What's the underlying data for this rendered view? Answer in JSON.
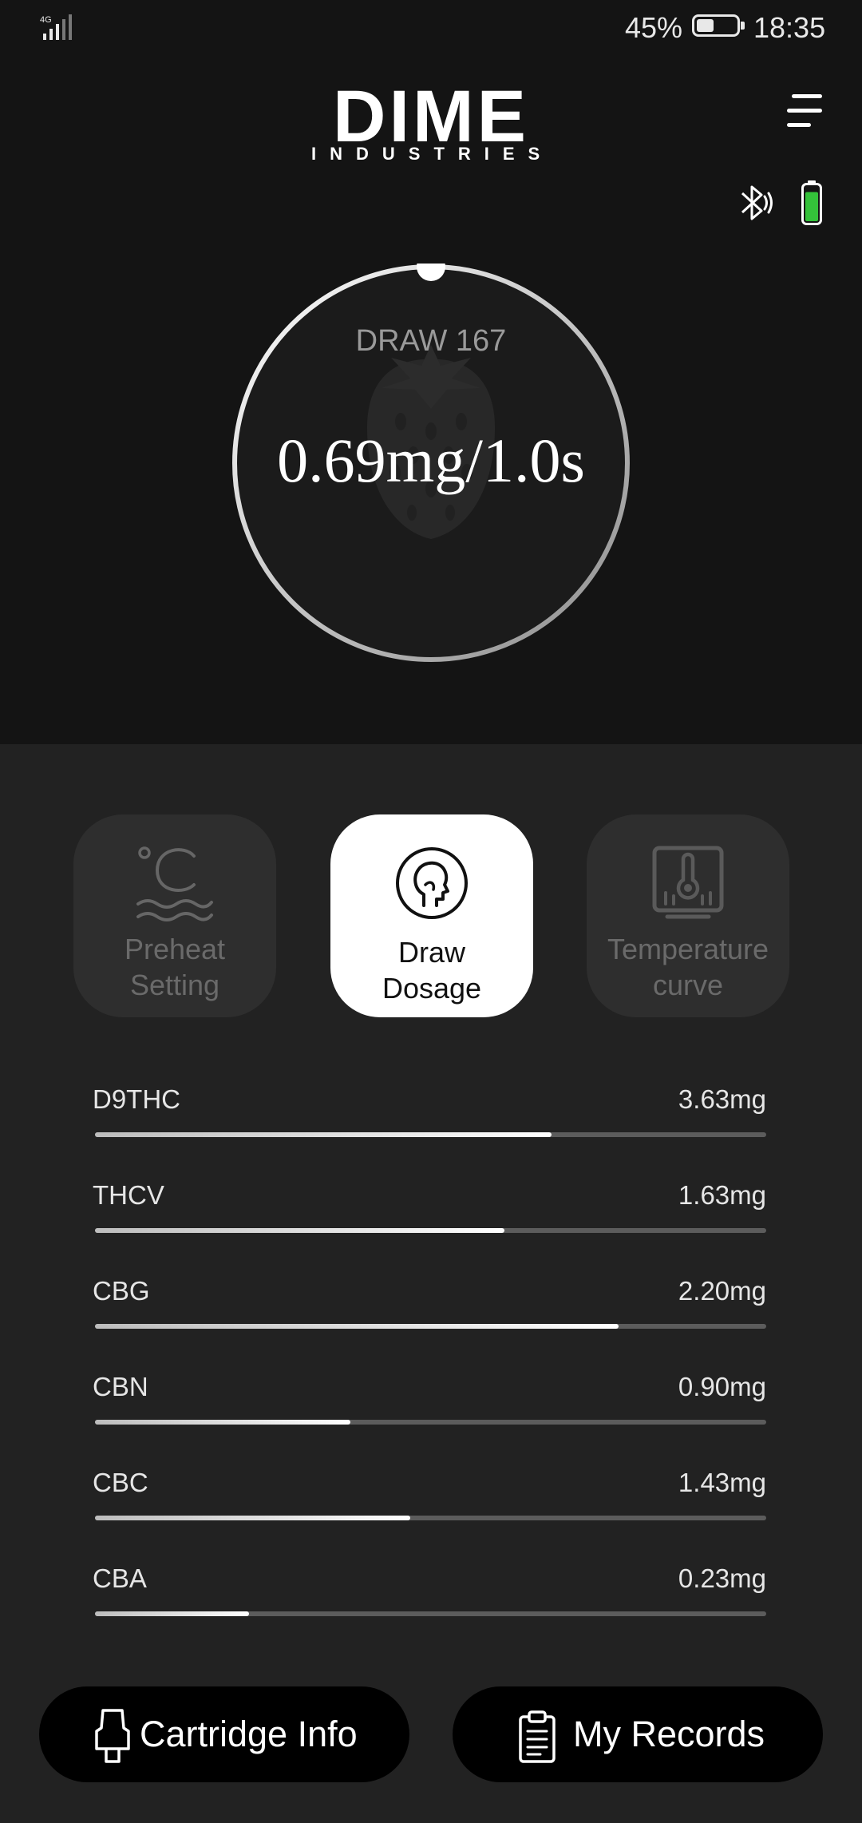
{
  "status_bar": {
    "network": "4G",
    "battery_percent": "45%",
    "time": "18:35",
    "battery_level": 0.45
  },
  "header": {
    "logo_main": "DIME",
    "logo_sub": "INDUSTRIES"
  },
  "device": {
    "bluetooth_connected": true,
    "battery_level": 0.85,
    "battery_color": "#34c23a"
  },
  "dial": {
    "draw_label": "DRAW 167",
    "dose_text": "0.69mg/1.0s",
    "background_icon": "strawberry-icon"
  },
  "modes": [
    {
      "label_line1": "Preheat",
      "label_line2": "Setting",
      "icon": "preheat-icon",
      "active": false
    },
    {
      "label_line1": "Draw",
      "label_line2": "Dosage",
      "icon": "head-icon",
      "active": true
    },
    {
      "label_line1": "Temperature",
      "label_line2": "curve",
      "icon": "thermometer-icon",
      "active": false
    }
  ],
  "cannabinoids": [
    {
      "name": "D9THC",
      "value": "3.63mg",
      "fraction": 0.68
    },
    {
      "name": "THCV",
      "value": "1.63mg",
      "fraction": 0.61
    },
    {
      "name": "CBG",
      "value": "2.20mg",
      "fraction": 0.78
    },
    {
      "name": "CBN",
      "value": "0.90mg",
      "fraction": 0.38
    },
    {
      "name": "CBC",
      "value": "1.43mg",
      "fraction": 0.47
    },
    {
      "name": "CBA",
      "value": "0.23mg",
      "fraction": 0.23
    }
  ],
  "actions": {
    "cartridge_info": "Cartridge Info",
    "my_records": "My Records"
  },
  "colors": {
    "background_top": "#141414",
    "background_bottom": "#222222",
    "tile_inactive": "#2e2e2e",
    "tile_active": "#ffffff",
    "button": "#000000"
  }
}
